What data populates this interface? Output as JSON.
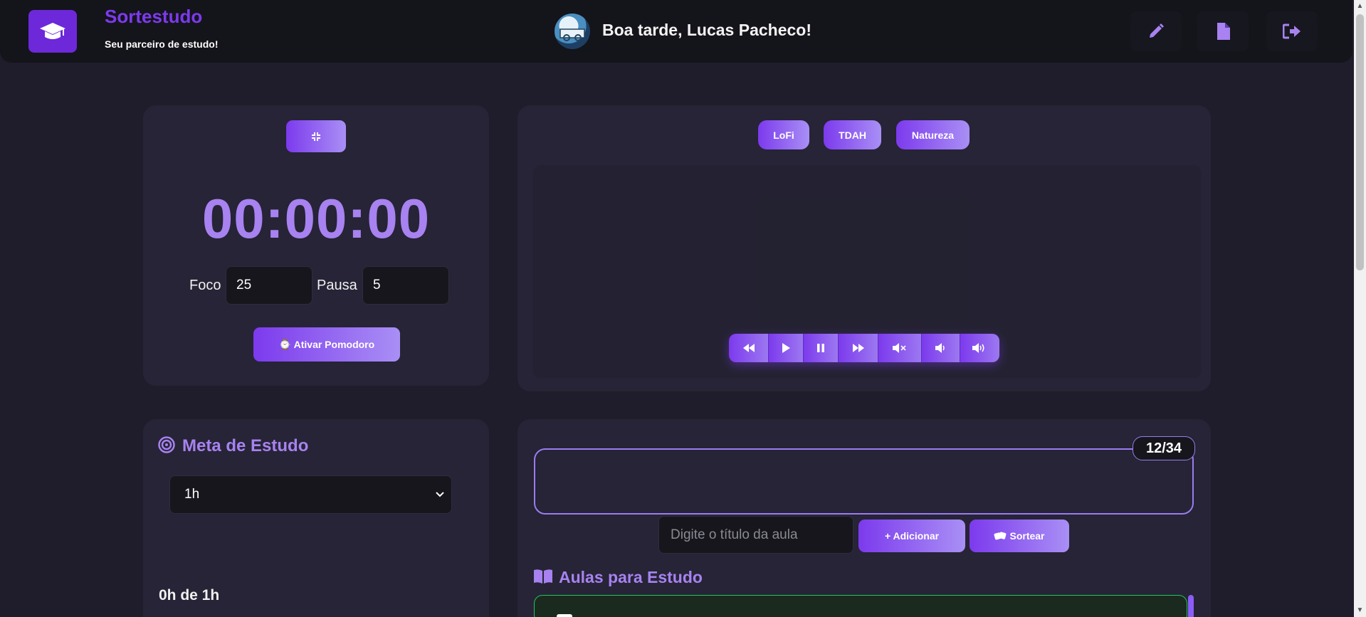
{
  "header": {
    "app_name": "Sortestudo",
    "tagline": "Seu parceiro de estudo!",
    "greeting": "Boa tarde, Lucas Pacheco!",
    "actions": [
      {
        "icon": "pencil-icon"
      },
      {
        "icon": "file-icon"
      },
      {
        "icon": "logout-icon"
      }
    ]
  },
  "timer": {
    "display": "00:00:00",
    "focus_label": "Foco",
    "focus_value": "25",
    "pause_label": "Pausa",
    "pause_value": "5",
    "activate_label": "⌚ Ativar Pomodoro"
  },
  "music": {
    "genres": [
      "LoFi",
      "TDAH",
      "Natureza"
    ],
    "controls": [
      "rewind-icon",
      "play-icon",
      "pause-icon",
      "fast-forward-icon",
      "mute-icon",
      "volume-down-icon",
      "volume-up-icon"
    ]
  },
  "goal": {
    "title": "Meta de Estudo",
    "selected": "1h",
    "progress_text": "0h de 1h"
  },
  "draw": {
    "counter": "12/34",
    "input_placeholder": "Digite o título da aula",
    "add_label": "+ Adicionar",
    "draw_label": "Sortear",
    "list_title": "Aulas para Estudo"
  },
  "colors": {
    "accent": "#7c3aed",
    "accent_light": "#a782f0",
    "background": "#1f1d2b",
    "card": "#262436"
  }
}
